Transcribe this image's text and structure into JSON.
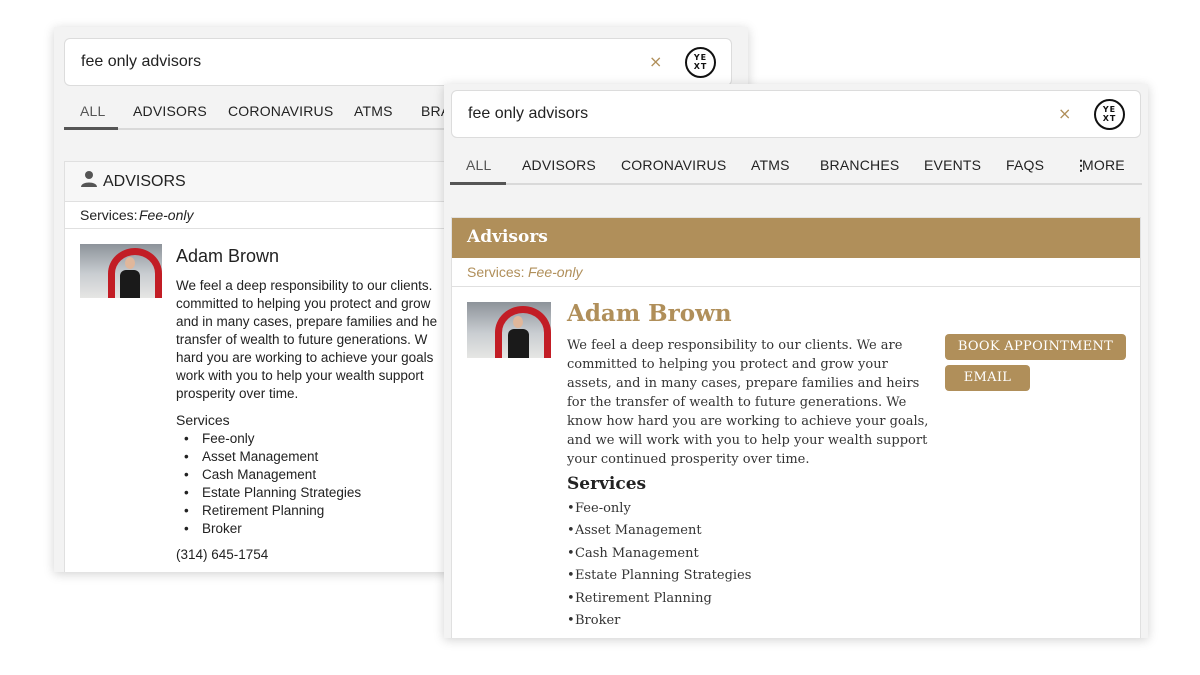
{
  "search": {
    "query": "fee only advisors",
    "clear_glyph": "×",
    "logo_text_line1": "YE",
    "logo_text_line2": "XT"
  },
  "back_panel": {
    "tabs": [
      "ALL",
      "ADVISORS",
      "CORONAVIRUS",
      "ATMS",
      "BRA"
    ],
    "section_title": "ADVISORS",
    "filter_label": "Services:",
    "filter_value": "Fee-only",
    "result": {
      "name": "Adam Brown",
      "bio_lines": [
        "We feel a deep responsibility to our clients.",
        "committed to helping you protect and grow",
        "and in many cases, prepare families and he",
        "transfer of wealth to future generations. W",
        "hard you are working to achieve your goals",
        "work with you to help your wealth support",
        "prosperity over time."
      ],
      "services_heading": "Services",
      "services": [
        "Fee-only",
        "Asset Management",
        "Cash Management",
        "Estate Planning Strategies",
        "Retirement Planning",
        "Broker"
      ],
      "phone": "(314) 645-1754"
    }
  },
  "front_panel": {
    "tabs": [
      "ALL",
      "ADVISORS",
      "CORONAVIRUS",
      "ATMS",
      "BRANCHES",
      "EVENTS",
      "FAQS"
    ],
    "more_label": "MORE",
    "section_title": "Advisors",
    "filter_label": "Services:",
    "filter_value": "Fee-only",
    "result": {
      "name": "Adam Brown",
      "bio_lines": [
        "We feel a deep responsibility to our clients. We are",
        "committed to helping you protect and grow your",
        "assets, and in many cases, prepare families and heirs",
        "for the transfer of wealth to future generations. We",
        "know how hard you are working to achieve your goals,",
        "and we will work with you to help your wealth support",
        "your continued prosperity over time."
      ],
      "services_heading": "Services",
      "services": [
        "Fee-only",
        "Asset Management",
        "Cash Management",
        "Estate Planning Strategies",
        "Retirement Planning",
        "Broker"
      ],
      "book_label": "BOOK APPOINTMENT",
      "email_label": "EMAIL"
    }
  },
  "colors": {
    "gold": "#b08f5a",
    "text": "#222222",
    "panel_bg": "#f3f3f3"
  }
}
